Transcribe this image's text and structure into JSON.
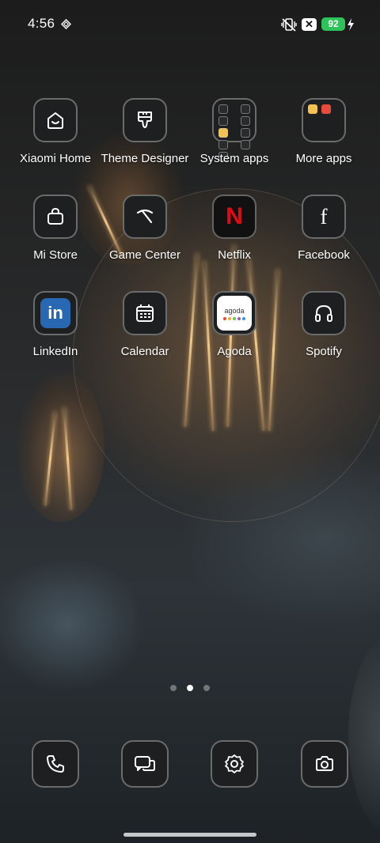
{
  "status_bar": {
    "time": "4:56",
    "battery_level": "92",
    "x_badge": "✕",
    "battery_color": "#2ec25a"
  },
  "apps": {
    "xiaomi_home": "Xiaomi Home",
    "theme_designer": "Theme Designer",
    "system_apps": "System apps",
    "more_apps": "More apps",
    "mi_store": "Mi Store",
    "game_center": "Game Center",
    "netflix": "Netflix",
    "facebook": "Facebook",
    "linkedin": "LinkedIn",
    "calendar": "Calendar",
    "agoda": "Agoda",
    "spotify": "Spotify"
  },
  "icon_text": {
    "netflix": "N",
    "facebook": "f",
    "linkedin": "in",
    "agoda": "agoda"
  },
  "page_indicator": {
    "pages": 3,
    "active_page": 2
  },
  "dock": [
    "phone-icon",
    "messages-icon",
    "settings-icon",
    "camera-icon"
  ],
  "colors": {
    "linkedin_blue": "#2867b2",
    "netflix_red": "#e50914"
  }
}
